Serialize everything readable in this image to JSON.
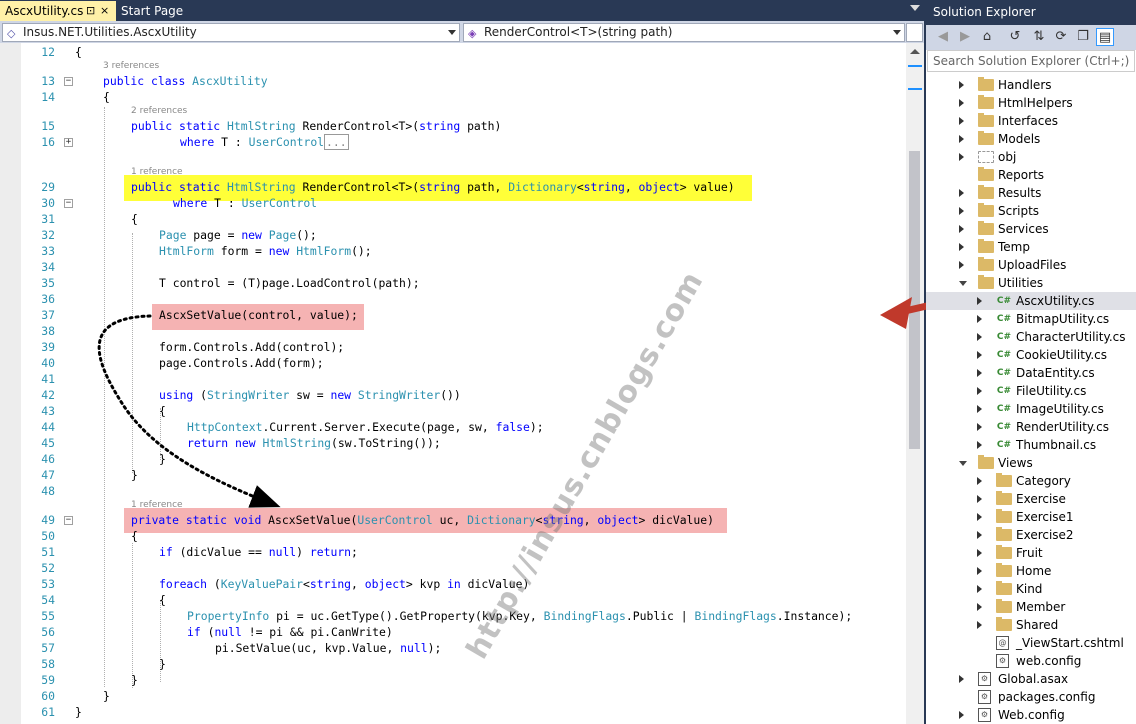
{
  "tabs": {
    "active": {
      "label": "AscxUtility.cs",
      "pin": "⊡",
      "close": "×"
    },
    "inactive": {
      "label": "Start Page"
    }
  },
  "nav": {
    "project": "Insus.NET.Utilities.AscxUtility",
    "member": "RenderControl<T>(string path)"
  },
  "code": {
    "line_numbers": [
      "12",
      "13",
      "14",
      "15",
      "16",
      "29",
      "30",
      "31",
      "32",
      "33",
      "34",
      "35",
      "36",
      "37",
      "38",
      "39",
      "40",
      "41",
      "42",
      "43",
      "44",
      "45",
      "46",
      "47",
      "48",
      "49",
      "50",
      "51",
      "52",
      "53",
      "54",
      "55",
      "56",
      "57",
      "58",
      "59",
      "60",
      "61"
    ],
    "refs": {
      "r1": "3 references",
      "r2": "2 references",
      "r3": "1 reference",
      "r4": "1 reference"
    },
    "l12": "{",
    "l13": [
      "public",
      " ",
      "class",
      " ",
      "AscxUtility"
    ],
    "l14": "{",
    "l15": [
      "public",
      " ",
      "static",
      " ",
      "HtmlString",
      " RenderControl<T>(",
      "string",
      " path)"
    ],
    "l16": [
      "where",
      " T : ",
      "UserControl",
      "..."
    ],
    "l29": [
      "public",
      " ",
      "static",
      " ",
      "HtmlString",
      " RenderControl<T>(",
      "string",
      " path, ",
      "Dictionary",
      "<",
      "string",
      ", ",
      "object",
      "> value)"
    ],
    "l30": [
      "where",
      " T : ",
      "UserControl"
    ],
    "l31": "{",
    "l32": [
      "Page",
      " page = ",
      "new",
      " ",
      "Page",
      "();"
    ],
    "l33": [
      "HtmlForm",
      " form = ",
      "new",
      " ",
      "HtmlForm",
      "();"
    ],
    "l35": "T control = (T)page.LoadControl(path);",
    "l37": "AscxSetValue(control, value);",
    "l39": "form.Controls.Add(control);",
    "l40": "page.Controls.Add(form);",
    "l42": [
      "using",
      " (",
      "StringWriter",
      " sw = ",
      "new",
      " ",
      "StringWriter",
      "())"
    ],
    "l43": "{",
    "l44": [
      "HttpContext",
      ".Current.Server.Execute(page, sw, ",
      "false",
      ");"
    ],
    "l45": [
      "return",
      " ",
      "new",
      " ",
      "HtmlString",
      "(sw.ToString());"
    ],
    "l46": "}",
    "l47": "}",
    "l49": [
      "private",
      " ",
      "static",
      " ",
      "void",
      " AscxSetValue(",
      "UserControl",
      " uc, ",
      "Dictionary",
      "<",
      "string",
      ", ",
      "object",
      "> dicValue)"
    ],
    "l50": "{",
    "l51": [
      "if",
      " (dicValue == ",
      "null",
      ") ",
      "return",
      ";"
    ],
    "l53": [
      "foreach",
      " (",
      "KeyValuePair",
      "<",
      "string",
      ", ",
      "object",
      "> kvp ",
      "in",
      " dicValue)"
    ],
    "l54": "{",
    "l55": [
      "PropertyInfo",
      " pi = uc.GetType().GetProperty(kvp.Key, ",
      "BindingFlags",
      ".Public | ",
      "BindingFlags",
      ".Instance);"
    ],
    "l56": [
      "if",
      " (",
      "null",
      " != pi && pi.CanWrite)"
    ],
    "l57": [
      "pi.SetValue(uc, kvp.Value, ",
      "null",
      ");"
    ],
    "l58": "}",
    "l59": "}",
    "l60": "}",
    "l61": "}"
  },
  "watermark": "http://insus.cnblogs.com",
  "solution_explorer": {
    "title": "Solution Explorer",
    "search_placeholder": "Search Solution Explorer (Ctrl+;)",
    "toolbar_icons": [
      "back-icon",
      "forward-icon",
      "home-icon",
      "history-icon",
      "pending-changes-icon",
      "refresh-icon",
      "collapse-all-icon",
      "show-all-files-icon"
    ],
    "items": [
      {
        "label": "Handlers",
        "icon": "folder"
      },
      {
        "label": "HtmlHelpers",
        "icon": "folder"
      },
      {
        "label": "Interfaces",
        "icon": "folder"
      },
      {
        "label": "Models",
        "icon": "folder"
      },
      {
        "label": "obj",
        "icon": "hidden-folder"
      },
      {
        "label": "Reports",
        "icon": "folder"
      },
      {
        "label": "Results",
        "icon": "folder"
      },
      {
        "label": "Scripts",
        "icon": "folder"
      },
      {
        "label": "Services",
        "icon": "folder"
      },
      {
        "label": "Temp",
        "icon": "folder"
      },
      {
        "label": "UploadFiles",
        "icon": "folder"
      },
      {
        "label": "Utilities",
        "icon": "folder"
      },
      {
        "label": "AscxUtility.cs",
        "icon": "csharp"
      },
      {
        "label": "BitmapUtility.cs",
        "icon": "csharp"
      },
      {
        "label": "CharacterUtility.cs",
        "icon": "csharp"
      },
      {
        "label": "CookieUtility.cs",
        "icon": "csharp"
      },
      {
        "label": "DataEntity.cs",
        "icon": "csharp"
      },
      {
        "label": "FileUtility.cs",
        "icon": "csharp"
      },
      {
        "label": "ImageUtility.cs",
        "icon": "csharp"
      },
      {
        "label": "RenderUtility.cs",
        "icon": "csharp"
      },
      {
        "label": "Thumbnail.cs",
        "icon": "csharp"
      },
      {
        "label": "Views",
        "icon": "folder"
      },
      {
        "label": "Category",
        "icon": "folder"
      },
      {
        "label": "Exercise",
        "icon": "folder"
      },
      {
        "label": "Exercise1",
        "icon": "folder"
      },
      {
        "label": "Exercise2",
        "icon": "folder"
      },
      {
        "label": "Fruit",
        "icon": "folder"
      },
      {
        "label": "Home",
        "icon": "folder"
      },
      {
        "label": "Kind",
        "icon": "folder"
      },
      {
        "label": "Member",
        "icon": "folder"
      },
      {
        "label": "Shared",
        "icon": "folder"
      },
      {
        "label": "_ViewStart.cshtml",
        "icon": "razor"
      },
      {
        "label": "web.config",
        "icon": "config"
      },
      {
        "label": "Global.asax",
        "icon": "asax"
      },
      {
        "label": "packages.config",
        "icon": "config"
      },
      {
        "label": "Web.config",
        "icon": "config"
      }
    ],
    "csharp_glyph": "C#",
    "razor_glyph": "@",
    "config_glyph": "⚙",
    "colors": {
      "selected_row": "#dfe0e6",
      "folder": "#dcb967",
      "csharp": "#388a34"
    }
  },
  "colors": {
    "keyword": "#0000ff",
    "type": "#2b91af",
    "line_number": "#2b91af",
    "highlight_yellow": "#ffff38",
    "highlight_pink": "#f5b3b3",
    "arrow_red": "#c0392b",
    "chrome": "#293955"
  }
}
